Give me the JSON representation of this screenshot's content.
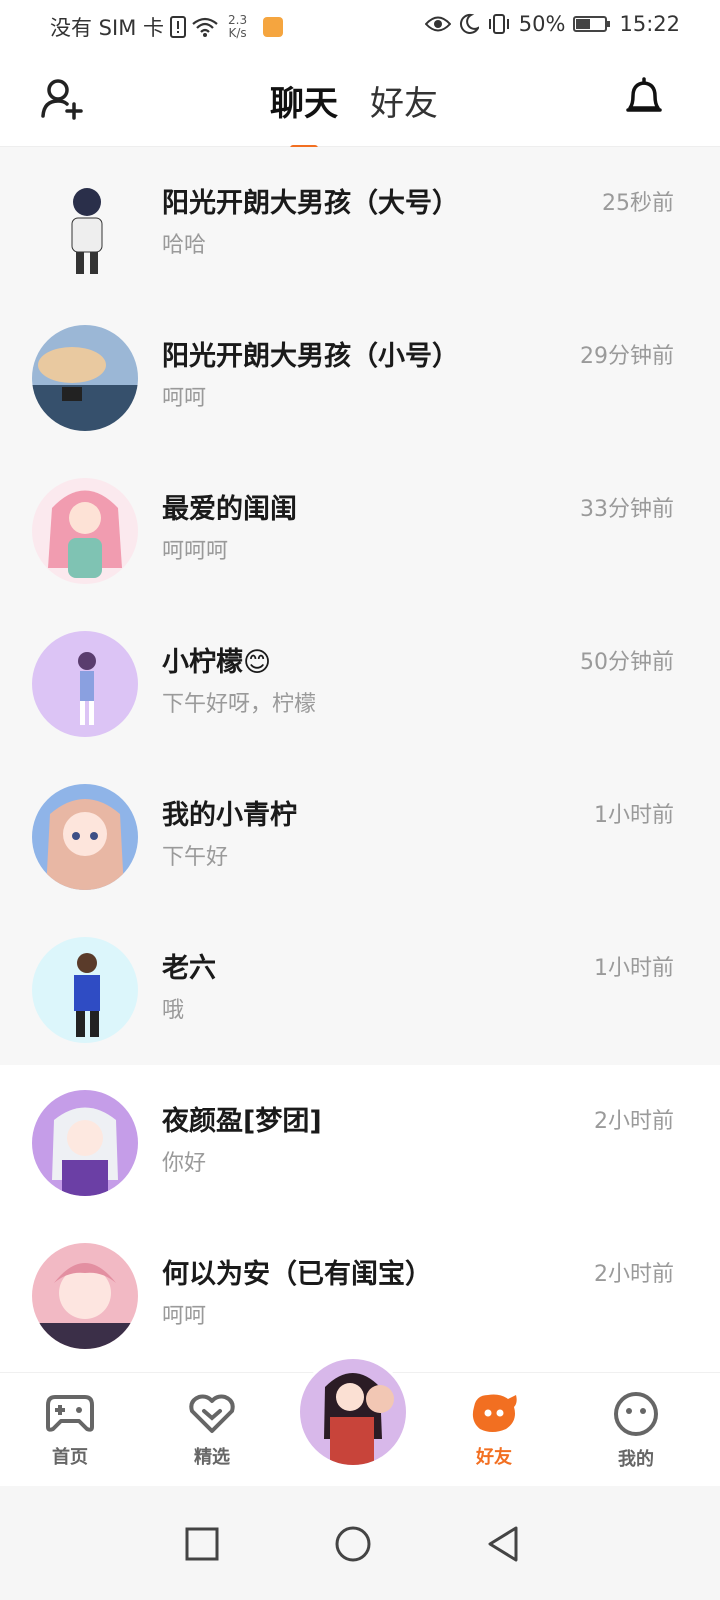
{
  "status_bar": {
    "carrier": "没有 SIM 卡",
    "speed_value": "2.3",
    "speed_unit": "K/s",
    "battery": "50%",
    "time": "15:22",
    "battery_level": 0.5
  },
  "header": {
    "tabs": [
      {
        "label": "聊天",
        "active": true
      },
      {
        "label": "好友",
        "active": false
      }
    ],
    "accent_color": "#f26f21"
  },
  "chats": [
    {
      "name": "阳光开朗大男孩（大号）",
      "message": "哈哈",
      "time": "25秒前"
    },
    {
      "name": "阳光开朗大男孩（小号）",
      "message": "呵呵",
      "time": "29分钟前"
    },
    {
      "name": "最爱的闺闺",
      "message": "呵呵呵",
      "time": "33分钟前"
    },
    {
      "name": "小柠檬😊",
      "message": "下午好呀，柠檬",
      "time": "50分钟前"
    },
    {
      "name": "我的小青柠",
      "message": "下午好",
      "time": "1小时前"
    },
    {
      "name": "老六",
      "message": "哦",
      "time": "1小时前"
    },
    {
      "name": "夜颜盈[梦团]",
      "message": "你好",
      "time": "2小时前"
    },
    {
      "name": "何以为安（已有闺宝）",
      "message": "呵呵",
      "time": "2小时前"
    }
  ],
  "bottom_nav": {
    "items": [
      {
        "label": "首页",
        "icon": "gamepad-icon"
      },
      {
        "label": "精选",
        "icon": "heart-badge-icon"
      },
      {
        "label": "好友",
        "icon": "friends-blob-icon",
        "active": true
      },
      {
        "label": "我的",
        "icon": "face-icon"
      }
    ]
  }
}
